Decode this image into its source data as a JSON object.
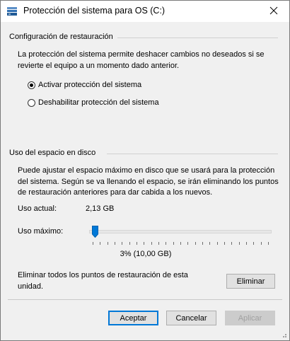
{
  "window": {
    "title": "Protección del sistema para OS (C:)"
  },
  "restore": {
    "group_label": "Configuración de restauración",
    "description": "La protección del sistema permite deshacer cambios no deseados si se revierte el equipo a un momento dado anterior.",
    "option_enable": "Activar protección del sistema",
    "option_disable": "Deshabilitar protección del sistema",
    "selected": "enable"
  },
  "disk": {
    "group_label": "Uso del espacio en disco",
    "description": "Puede ajustar el espacio máximo en disco que se usará para la protección del sistema. Según se va llenando el espacio, se irán eliminando los puntos de restauración anteriores para dar cabida a los nuevos.",
    "current_label": "Uso actual:",
    "current_value": "2,13 GB",
    "max_label": "Uso máximo:",
    "slider_percent": 3,
    "slider_value_text": "3% (10,00 GB)",
    "delete_text": "Eliminar todos los puntos de restauración de esta unidad.",
    "delete_button": "Eliminar"
  },
  "buttons": {
    "accept": "Aceptar",
    "cancel": "Cancelar",
    "apply": "Aplicar"
  },
  "colors": {
    "accent": "#0078d7",
    "dialog_bg": "#f0f0f0",
    "button_bg": "#e1e1e1",
    "disabled_text": "#a0a0a0"
  },
  "icons": {
    "title": "system-protection-icon",
    "close": "close-icon"
  }
}
